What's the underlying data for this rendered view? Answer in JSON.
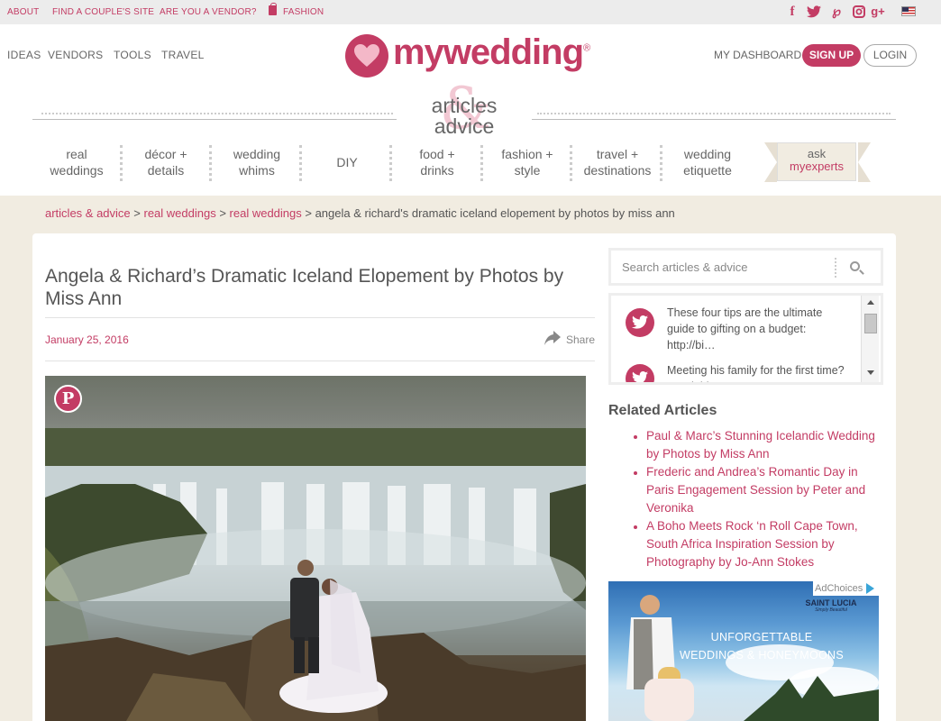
{
  "topbar": {
    "links": [
      "ABOUT",
      "FIND A COUPLE'S SITE",
      "ARE YOU A VENDOR?"
    ],
    "fashion": "FASHION",
    "social": [
      "facebook-icon",
      "twitter-icon",
      "pinterest-icon",
      "instagram-icon",
      "google-plus-icon"
    ]
  },
  "header": {
    "nav": [
      "IDEAS",
      "VENDORS",
      "TOOLS",
      "TRAVEL"
    ],
    "logo": "mywedding",
    "logo_mark": "®",
    "dashboard": "MY DASHBOARD",
    "signup": "SIGN UP",
    "login": "LOGIN",
    "section_title_1": "articles",
    "section_title_2": "advice",
    "amp": "&"
  },
  "categories": [
    {
      "line1": "real",
      "line2": "weddings"
    },
    {
      "line1": "décor +",
      "line2": "details"
    },
    {
      "line1": "wedding",
      "line2": "whims"
    },
    {
      "line1": "DIY",
      "line2": ""
    },
    {
      "line1": "food +",
      "line2": "drinks"
    },
    {
      "line1": "fashion +",
      "line2": "style"
    },
    {
      "line1": "travel +",
      "line2": "destinations"
    },
    {
      "line1": "wedding",
      "line2": "etiquette"
    }
  ],
  "ask": {
    "line1": "ask",
    "line2": "myexperts"
  },
  "breadcrumb": {
    "items": [
      "articles & advice",
      "real weddings",
      "real weddings"
    ],
    "current": "angela & richard's dramatic iceland elopement by photos by miss ann"
  },
  "article": {
    "title": "Angela & Richard’s Dramatic Iceland Elopement by Photos by Miss Ann",
    "date": "January 25, 2016",
    "share": "Share"
  },
  "sidebar": {
    "search_placeholder": "Search articles & advice",
    "tweets": [
      "These four tips are the ultimate guide to gifting on a budget: http://bi…",
      "Meeting his family for the first time? Read this…"
    ],
    "related_heading": "Related Articles",
    "related": [
      "Paul & Marc’s Stunning Icelandic Wedding by Photos by Miss Ann",
      "Frederic and Andrea’s Romantic Day in Paris Engagement Session by Peter and Veronika",
      "A Boho Meets Rock ‘n Roll Cape Town, South Africa Inspiration Session by Photography by Jo-Ann Stokes"
    ],
    "ad": {
      "adchoices": "AdChoices",
      "brand": "SAINT LUCIA",
      "brand_tag": "Simply Beautiful",
      "line1": "UNFORGETTABLE",
      "line2": "WEDDINGS & HONEYMOONS"
    }
  },
  "colors": {
    "accent": "#c33c64",
    "background": "#f1ece1"
  }
}
